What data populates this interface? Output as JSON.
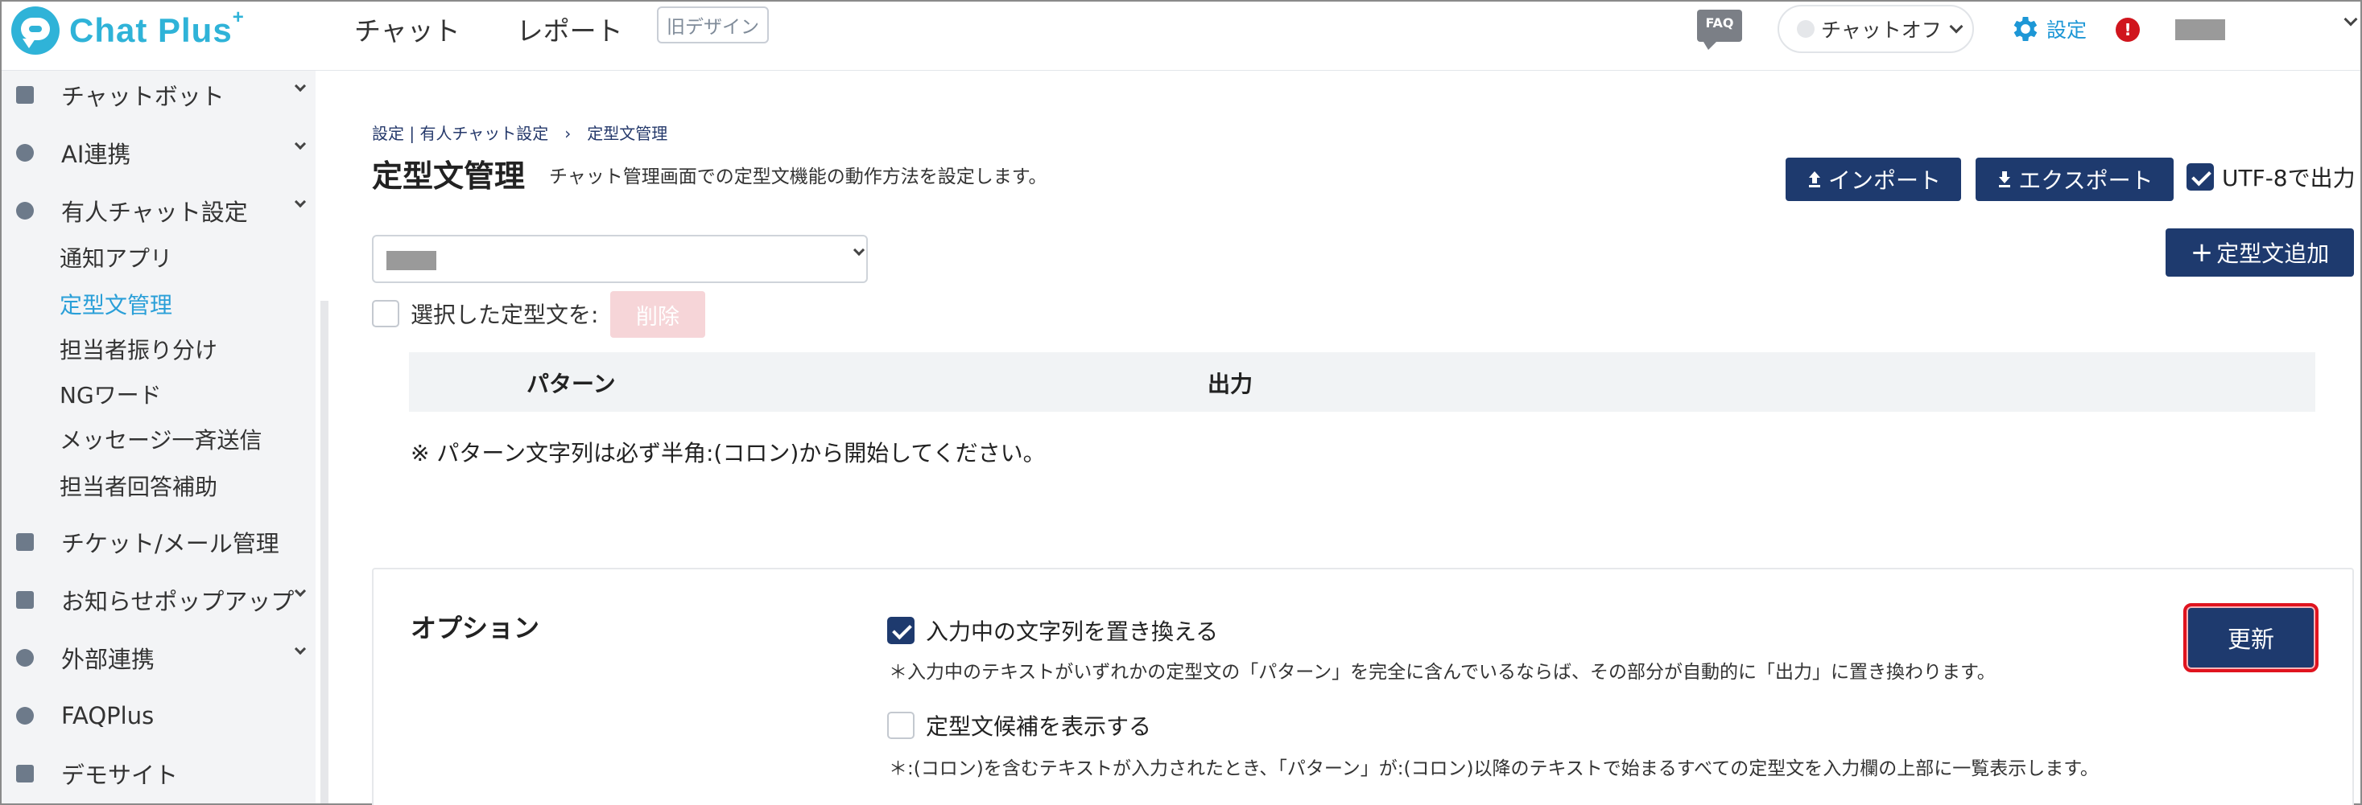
{
  "app": {
    "logo_text": "Chat Plus",
    "logo_sup": "+"
  },
  "topnav": {
    "items": [
      "チャット",
      "レポート"
    ],
    "old_design": "旧デザイン"
  },
  "header": {
    "faq_label": "FAQ",
    "chat_toggle": "チャットオフ",
    "settings_label": "設定",
    "alert_label": "!"
  },
  "sidebar": {
    "items": [
      {
        "label": "チャットボット"
      },
      {
        "label": "AI連携"
      },
      {
        "label": "有人チャット設定"
      },
      {
        "label": "チケット/メール管理"
      },
      {
        "label": "お知らせポップアップ"
      },
      {
        "label": "外部連携"
      },
      {
        "label": "FAQPlus"
      },
      {
        "label": "デモサイト"
      }
    ],
    "subitems": [
      "通知アプリ",
      "定型文管理",
      "担当者振り分け",
      "NGワード",
      "メッセージ一斉送信",
      "担当者回答補助"
    ]
  },
  "main": {
    "breadcrumb": "設定 | 有人チャット設定　›　定型文管理",
    "title": "定型文管理",
    "description": "チャット管理画面での定型文機能の動作方法を設定します。",
    "import_label": "インポート",
    "export_label": "エクスポート",
    "utf8_label": "UTF-8で出力",
    "add_label": "定型文追加",
    "selected_label": "選択した定型文を:",
    "delete_label": "削除",
    "table": {
      "col_pattern": "パターン",
      "col_output": "出力"
    },
    "note": "※ パターン文字列は必ず半角:(コロン)から開始してください。"
  },
  "options": {
    "title": "オプション",
    "opt1_label": "入力中の文字列を置き換える",
    "opt1_desc": "＊入力中のテキストがいずれかの定型文の「パターン」を完全に含んでいるならば、その部分が自動的に「出力」に置き換わります。",
    "opt2_label": "定型文候補を表示する",
    "opt2_desc": "＊:(コロン)を含むテキストが入力されたとき、「パターン」が:(コロン)以降のテキストで始まるすべての定型文を入力欄の上部に一覧表示します。",
    "update_label": "更新"
  },
  "colors": {
    "navy": "#1e3a6e",
    "brand": "#2fb3d8",
    "link": "#2a9fd8",
    "alert": "#d0151d"
  }
}
